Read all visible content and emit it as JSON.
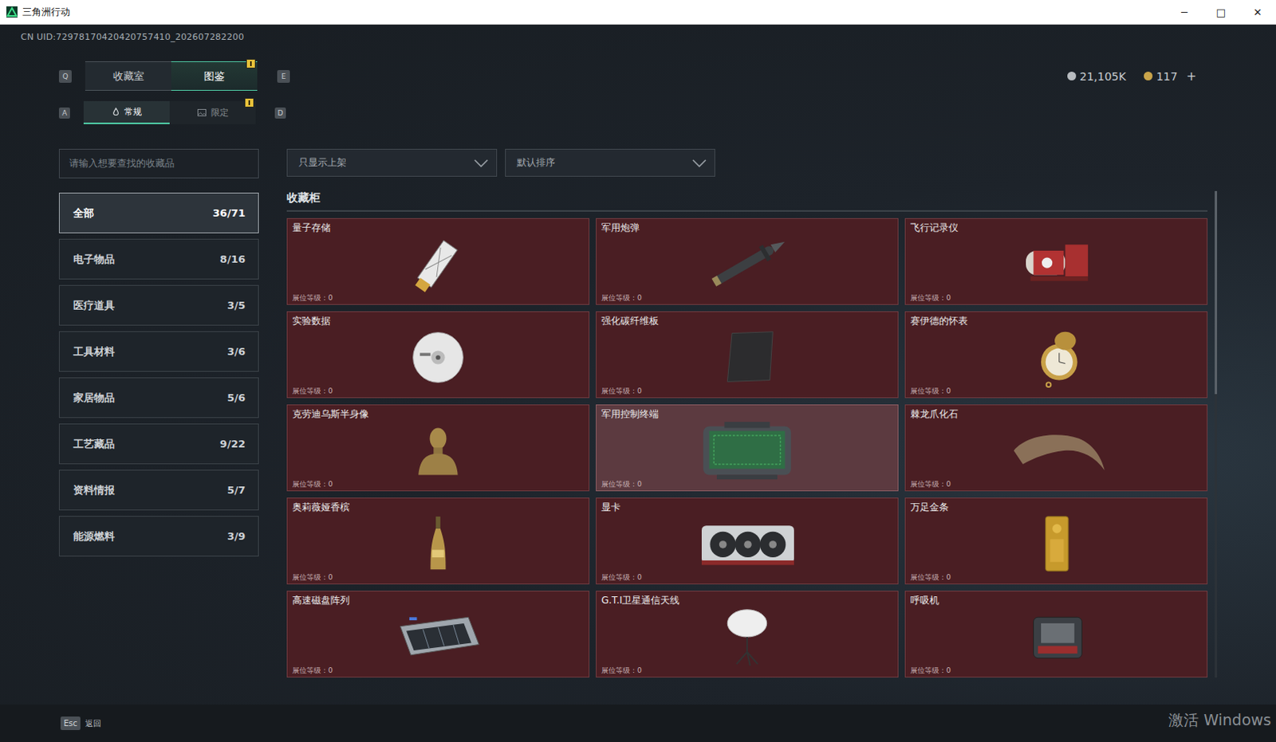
{
  "window": {
    "title": "三角洲行动",
    "controls": [
      "─",
      "□",
      "✕"
    ]
  },
  "uid": "CN UID:72978170420420757410_202607282200",
  "currency": [
    {
      "value": "21,105K",
      "suffix": "",
      "color": "#b8bcc0"
    },
    {
      "value": "117",
      "suffix": "+",
      "color": "#c9a44a"
    }
  ],
  "tabs": {
    "prev_key": "Q",
    "next_key": "E",
    "items": [
      {
        "label": "收藏室",
        "selected": false,
        "badge": false
      },
      {
        "label": "图鉴",
        "selected": true,
        "badge": true
      }
    ]
  },
  "subtabs": {
    "prev_key": "A",
    "next_key": "D",
    "items": [
      {
        "label": "常规",
        "selected": true,
        "badge": false,
        "kind": "flame"
      },
      {
        "label": "限定",
        "selected": false,
        "badge": true,
        "kind": "image"
      }
    ]
  },
  "search": {
    "placeholder": "请输入想要查找的收藏品"
  },
  "filters": [
    {
      "label": "只显示上架"
    },
    {
      "label": "默认排序"
    }
  ],
  "sidebar": {
    "items": [
      {
        "label": "全部",
        "count": "36/71",
        "selected": true
      },
      {
        "label": "电子物品",
        "count": "8/16",
        "selected": false
      },
      {
        "label": "医疗道具",
        "count": "3/5",
        "selected": false
      },
      {
        "label": "工具材料",
        "count": "3/6",
        "selected": false
      },
      {
        "label": "家居物品",
        "count": "5/6",
        "selected": false
      },
      {
        "label": "工艺藏品",
        "count": "9/22",
        "selected": false
      },
      {
        "label": "资料情报",
        "count": "5/7",
        "selected": false
      },
      {
        "label": "能源燃料",
        "count": "3/9",
        "selected": false
      }
    ]
  },
  "section_title": "收藏柜",
  "items": [
    {
      "name": "量子存储",
      "level_text": "展位等级：0",
      "kind": "usb",
      "highlighted": false
    },
    {
      "name": "军用炮弹",
      "level_text": "展位等级：0",
      "kind": "shell",
      "highlighted": false
    },
    {
      "name": "飞行记录仪",
      "level_text": "展位等级：0",
      "kind": "recorder",
      "highlighted": false
    },
    {
      "name": "实验数据",
      "level_text": "展位等级：0",
      "kind": "disc",
      "highlighted": false
    },
    {
      "name": "强化碳纤维板",
      "level_text": "展位等级：0",
      "kind": "plate",
      "highlighted": false
    },
    {
      "name": "赛伊德的怀表",
      "level_text": "展位等级：0",
      "kind": "watch",
      "highlighted": false
    },
    {
      "name": "克劳迪乌斯半身像",
      "level_text": "展位等级：0",
      "kind": "bust",
      "highlighted": false
    },
    {
      "name": "军用控制终端",
      "level_text": "展位等级：0",
      "kind": "terminal",
      "highlighted": true
    },
    {
      "name": "棘龙爪化石",
      "level_text": "展位等级：0",
      "kind": "claw",
      "highlighted": false
    },
    {
      "name": "奥莉薇娅香槟",
      "level_text": "展位等级：0",
      "kind": "bottle",
      "highlighted": false
    },
    {
      "name": "显卡",
      "level_text": "展位等级：0",
      "kind": "gpu",
      "highlighted": false
    },
    {
      "name": "万足金条",
      "level_text": "展位等级：0",
      "kind": "gold",
      "highlighted": false
    },
    {
      "name": "高速磁盘阵列",
      "level_text": "展位等级：0",
      "kind": "raid",
      "highlighted": false
    },
    {
      "name": "G.T.I卫星通信天线",
      "level_text": "展位等级：0",
      "kind": "dish",
      "highlighted": false
    },
    {
      "name": "呼吸机",
      "level_text": "展位等级：0",
      "kind": "ventilator",
      "highlighted": false
    }
  ],
  "footer": {
    "key": "Esc",
    "label": "返回"
  },
  "watermark": "激活 Windows"
}
